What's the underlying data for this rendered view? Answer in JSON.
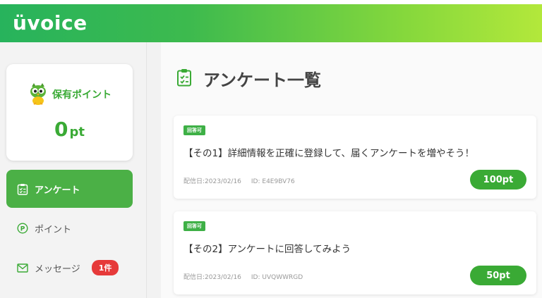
{
  "header": {
    "logo": "üvoice"
  },
  "sidebar": {
    "points_label": "保有ポイント",
    "points_value": "0",
    "points_unit": "pt",
    "nav": [
      {
        "label": "アンケート",
        "icon": "clipboard-icon",
        "active": true
      },
      {
        "label": "ポイント",
        "icon": "point-coin-icon",
        "active": false
      },
      {
        "label": "メッセージ",
        "icon": "mail-icon",
        "active": false,
        "badge": "1件"
      }
    ]
  },
  "main": {
    "title": "アンケート一覧",
    "surveys": [
      {
        "tag": "回答可",
        "title": "【その1】詳細情報を正確に登録して、届くアンケートを増やそう！",
        "date": "配信日:2023/02/16",
        "id": "ID: E4E9BV76",
        "points": "100pt"
      },
      {
        "tag": "回答可",
        "title": "【その2】アンケートに回答してみよう",
        "date": "配信日:2023/02/16",
        "id": "ID: UVQWWRGD",
        "points": "50pt"
      }
    ]
  },
  "colors": {
    "brand_green": "#3aaa35",
    "badge_red": "#e63a3a"
  }
}
